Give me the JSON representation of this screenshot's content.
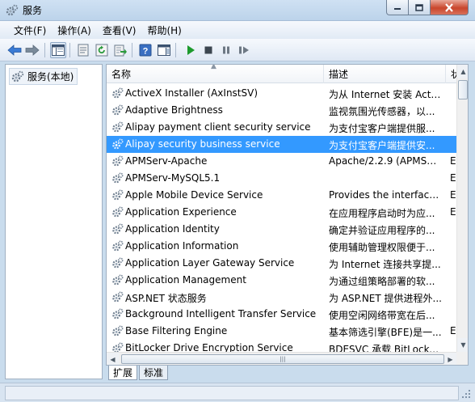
{
  "window": {
    "title": "服务"
  },
  "menu": [
    "文件(F)",
    "操作(A)",
    "查看(V)",
    "帮助(H)"
  ],
  "tree": {
    "root_label": "服务(本地)"
  },
  "columns": {
    "name": "名称",
    "description": "描述",
    "status": "状"
  },
  "services": [
    {
      "name": "ActiveX Installer (AxInstSV)",
      "description": "为从 Internet 安装 Acti...",
      "status": ""
    },
    {
      "name": "Adaptive Brightness",
      "description": "监视氛围光传感器，以...",
      "status": ""
    },
    {
      "name": "Alipay payment client security service",
      "description": "为支付宝客户端提供服...",
      "status": ""
    },
    {
      "name": "Alipay security business service",
      "description": "为支付宝客户端提供安...",
      "status": "",
      "selected": true
    },
    {
      "name": "APMServ-Apache",
      "description": "Apache/2.2.9 (APMSer...",
      "status": "E"
    },
    {
      "name": "APMServ-MySQL5.1",
      "description": "",
      "status": "E"
    },
    {
      "name": "Apple Mobile Device Service",
      "description": "Provides the interface...",
      "status": "E"
    },
    {
      "name": "Application Experience",
      "description": "在应用程序启动时为应...",
      "status": "E"
    },
    {
      "name": "Application Identity",
      "description": "确定并验证应用程序的...",
      "status": ""
    },
    {
      "name": "Application Information",
      "description": "使用辅助管理权限便于...",
      "status": ""
    },
    {
      "name": "Application Layer Gateway Service",
      "description": "为 Internet 连接共享提...",
      "status": ""
    },
    {
      "name": "Application Management",
      "description": "为通过组策略部署的软...",
      "status": ""
    },
    {
      "name": "ASP.NET 状态服务",
      "description": "为 ASP.NET 提供进程外...",
      "status": ""
    },
    {
      "name": "Background Intelligent Transfer Service",
      "description": "使用空闲网络带宽在后...",
      "status": ""
    },
    {
      "name": "Base Filtering Engine",
      "description": "基本筛选引擎(BFE)是一...",
      "status": "E"
    },
    {
      "name": "BitLocker Drive Encryption Service",
      "description": "BDESVC 承载 BitLocke...",
      "status": ""
    }
  ],
  "tabs": {
    "extended": "扩展",
    "standard": "标准",
    "active": "extended"
  },
  "icons": {
    "app": "services-gear-icon",
    "service": "gear-icon",
    "toolbar": [
      "back-arrow-icon",
      "forward-arrow-icon",
      "show-tree-icon",
      "properties-icon",
      "refresh-icon",
      "export-list-icon",
      "help-icon",
      "action-pane-icon",
      "start-service-icon",
      "stop-service-icon",
      "pause-service-icon",
      "restart-service-icon"
    ]
  },
  "colors": {
    "selection": "#3399ff",
    "play": "#1d9a2d"
  }
}
